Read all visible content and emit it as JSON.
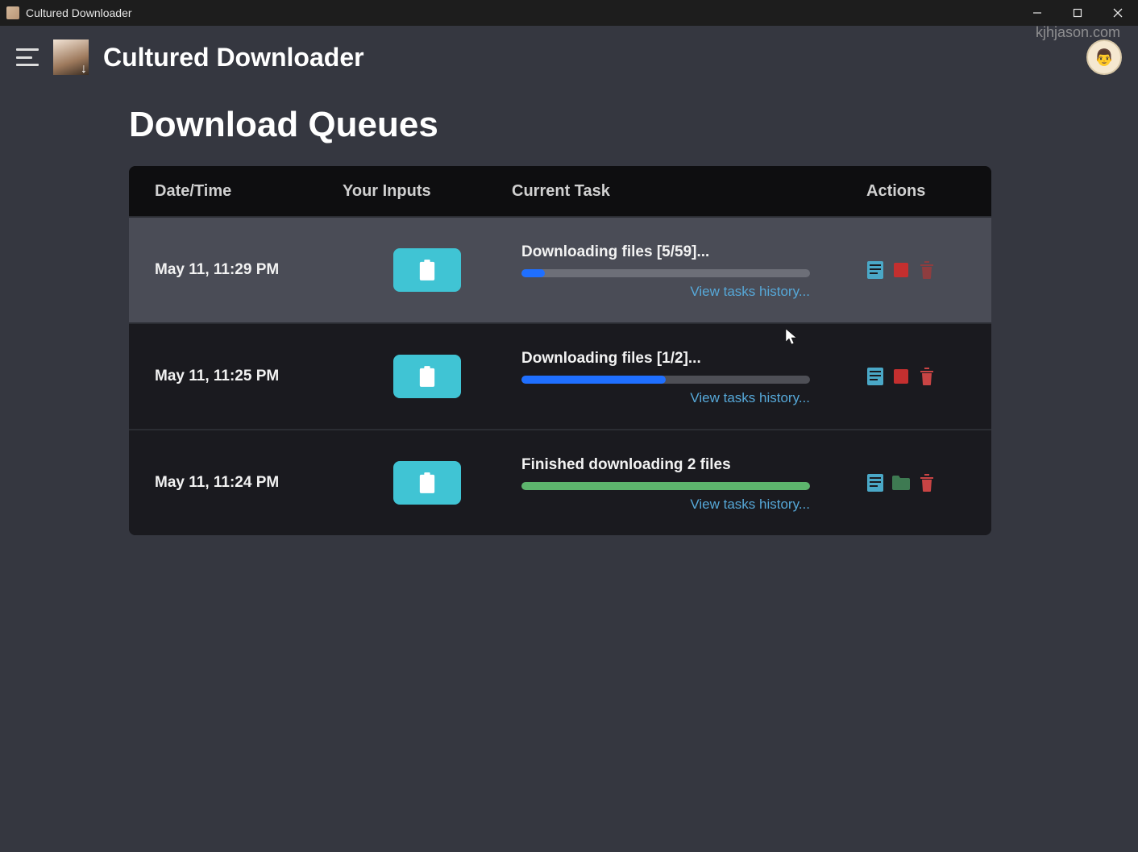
{
  "window": {
    "title": "Cultured Downloader"
  },
  "watermark": "kjhjason.com",
  "header": {
    "app_name": "Cultured Downloader"
  },
  "page": {
    "title": "Download Queues"
  },
  "table": {
    "headers": {
      "date": "Date/Time",
      "inputs": "Your Inputs",
      "task": "Current Task",
      "actions": "Actions"
    },
    "history_link_label": "View tasks history...",
    "rows": [
      {
        "date": "May 11, 11:29 PM",
        "task": "Downloading files [5/59]...",
        "progress_pct": 8,
        "progress_color": "blue",
        "highlight": true,
        "actions": [
          "file",
          "stop",
          "trash-dim"
        ]
      },
      {
        "date": "May 11, 11:25 PM",
        "task": "Downloading files [1/2]...",
        "progress_pct": 50,
        "progress_color": "blue",
        "highlight": false,
        "actions": [
          "file",
          "stop",
          "trash"
        ]
      },
      {
        "date": "May 11, 11:24 PM",
        "task": "Finished downloading 2 files",
        "progress_pct": 100,
        "progress_color": "green",
        "highlight": false,
        "actions": [
          "file",
          "folder",
          "trash"
        ]
      }
    ]
  }
}
